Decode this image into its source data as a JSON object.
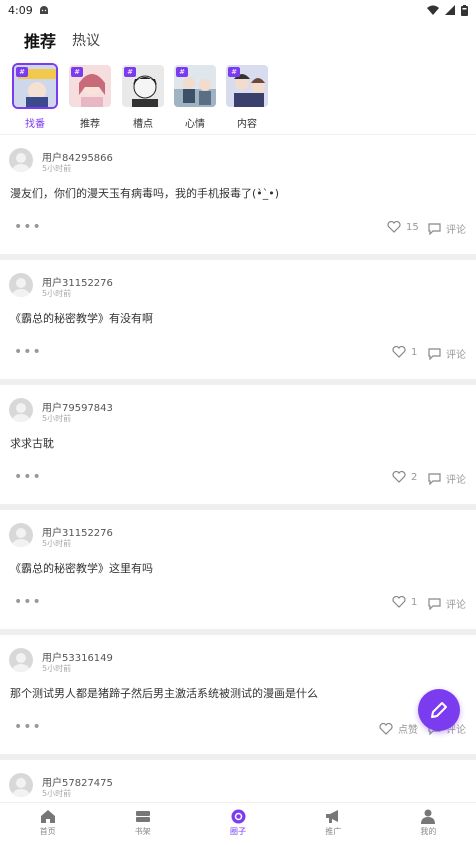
{
  "status_bar": {
    "time": "4:09"
  },
  "header": {
    "tabs": [
      {
        "label": "推荐",
        "active": true
      },
      {
        "label": "热议",
        "active": false
      }
    ]
  },
  "stories": [
    {
      "label": "找番",
      "active": true
    },
    {
      "label": "推荐",
      "active": false
    },
    {
      "label": "槽点",
      "active": false
    },
    {
      "label": "心情",
      "active": false
    },
    {
      "label": "内容",
      "active": false
    }
  ],
  "posts": [
    {
      "user": "用户84295866",
      "time": "5小时前",
      "content": "漫友们，你们的漫天玉有病毒吗，我的手机报毒了(•̀_̀•)",
      "likes": "15",
      "comment_label": "评论"
    },
    {
      "user": "用户31152276",
      "time": "5小时前",
      "content": "《霸总的秘密教学》有没有啊",
      "likes": "1",
      "comment_label": "评论"
    },
    {
      "user": "用户79597843",
      "time": "5小时前",
      "content": "求求古耽",
      "likes": "2",
      "comment_label": "评论"
    },
    {
      "user": "用户31152276",
      "time": "5小时前",
      "content": "《霸总的秘密教学》这里有吗",
      "likes": "1",
      "comment_label": "评论"
    },
    {
      "user": "用户53316149",
      "time": "5小时前",
      "content": "那个测试男人都是猪蹄子然后男主激活系统被测试的漫画是什么",
      "likes": "点赞",
      "comment_label": "评论"
    },
    {
      "user": "用户57827475",
      "time": "5小时前",
      "content": "",
      "likes": "",
      "comment_label": ""
    }
  ],
  "bottom_nav": [
    {
      "label": "首页",
      "icon": "home-icon",
      "active": false
    },
    {
      "label": "书架",
      "icon": "bookshelf-icon",
      "active": false
    },
    {
      "label": "圈子",
      "icon": "circle-icon",
      "active": true
    },
    {
      "label": "推广",
      "icon": "megaphone-icon",
      "active": false
    },
    {
      "label": "我的",
      "icon": "user-icon",
      "active": false
    }
  ],
  "colors": {
    "accent": "#7b3cf0",
    "tab_underline": "#3ec7b3"
  }
}
